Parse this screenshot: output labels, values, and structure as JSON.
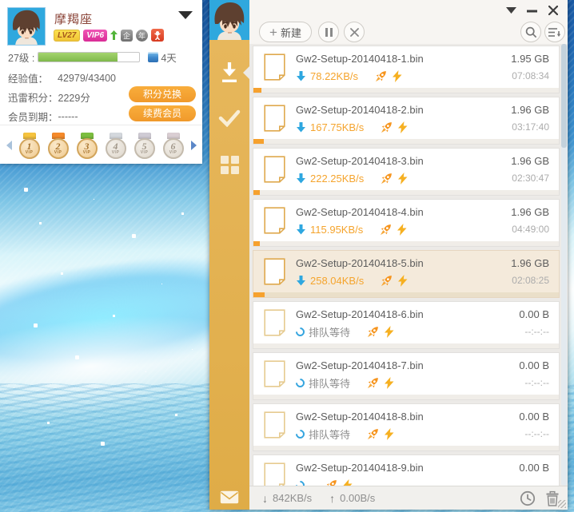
{
  "user_card": {
    "username": "摩羯座",
    "badges": {
      "level": "LV27",
      "vip": "VIP6",
      "enterprise": "企",
      "year": "年"
    },
    "level_row": {
      "label": "27级 :",
      "progress_percent": 78,
      "days_text": "4天"
    },
    "exp_row": {
      "label": "经验值：",
      "value": "42979/43400"
    },
    "points_row": {
      "label": "迅雷积分：",
      "value": "2229分",
      "button_label": "积分兑换"
    },
    "member_row": {
      "label": "会员到期：",
      "value": "------",
      "button_label": "续费会员"
    },
    "medals": [
      {
        "num": "1",
        "vip": "VIP",
        "active": true,
        "ribbon": "#F6C33E"
      },
      {
        "num": "2",
        "vip": "VIP",
        "active": true,
        "ribbon": "#F58A2A"
      },
      {
        "num": "3",
        "vip": "VIP",
        "active": true,
        "ribbon": "#7CBE3F"
      },
      {
        "num": "4",
        "vip": "VIP",
        "active": false,
        "ribbon": "#B9CFE8"
      },
      {
        "num": "5",
        "vip": "VIP",
        "active": false,
        "ribbon": "#CDB6E3"
      },
      {
        "num": "6",
        "vip": "VIP",
        "active": false,
        "ribbon": "#F0B6CD"
      }
    ]
  },
  "main": {
    "toolbar": {
      "new_label": "新建"
    },
    "downloads": [
      {
        "name": "Gw2-Setup-20140418-1.bin",
        "state": "downloading",
        "speed": "78.22KB/s",
        "size": "1.95 GB",
        "eta": "07:08:34",
        "progress": 2.6,
        "selected": false
      },
      {
        "name": "Gw2-Setup-20140418-2.bin",
        "state": "downloading",
        "speed": "167.75KB/s",
        "size": "1.96 GB",
        "eta": "03:17:40",
        "progress": 3.4,
        "selected": false
      },
      {
        "name": "Gw2-Setup-20140418-3.bin",
        "state": "downloading",
        "speed": "222.25KB/s",
        "size": "1.96 GB",
        "eta": "02:30:47",
        "progress": 2.2,
        "selected": false
      },
      {
        "name": "Gw2-Setup-20140418-4.bin",
        "state": "downloading",
        "speed": "115.95KB/s",
        "size": "1.96 GB",
        "eta": "04:49:00",
        "progress": 2.2,
        "selected": false
      },
      {
        "name": "Gw2-Setup-20140418-5.bin",
        "state": "downloading",
        "speed": "258.04KB/s",
        "size": "1.96 GB",
        "eta": "02:08:25",
        "progress": 3.6,
        "selected": true
      },
      {
        "name": "Gw2-Setup-20140418-6.bin",
        "state": "queued",
        "status": "排队等待",
        "size": "0.00 B",
        "eta": "--:--:--",
        "progress": 0,
        "selected": false
      },
      {
        "name": "Gw2-Setup-20140418-7.bin",
        "state": "queued",
        "status": "排队等待",
        "size": "0.00 B",
        "eta": "--:--:--",
        "progress": 0,
        "selected": false
      },
      {
        "name": "Gw2-Setup-20140418-8.bin",
        "state": "queued",
        "status": "排队等待",
        "size": "0.00 B",
        "eta": "--:--:--",
        "progress": 0,
        "selected": false
      },
      {
        "name": "Gw2-Setup-20140418-9.bin",
        "state": "queued",
        "status": "",
        "size": "0.00 B",
        "eta": "",
        "progress": 0,
        "selected": false
      }
    ],
    "statusbar": {
      "down_speed": "842KB/s",
      "up_speed": "0.00B/s"
    }
  },
  "colors": {
    "sidebar_gold": "#E2B052",
    "speed_orange": "#F5A42D",
    "progress_fill_orange": "#F6A12E",
    "exp_green": "#8CC152",
    "vip_magenta": "#E03BA2",
    "level_gold": "#F5D34A",
    "link_blue": "#2EA7E0",
    "selected_row_bg": "#F4EADB",
    "button_orange": "#F5A032"
  }
}
